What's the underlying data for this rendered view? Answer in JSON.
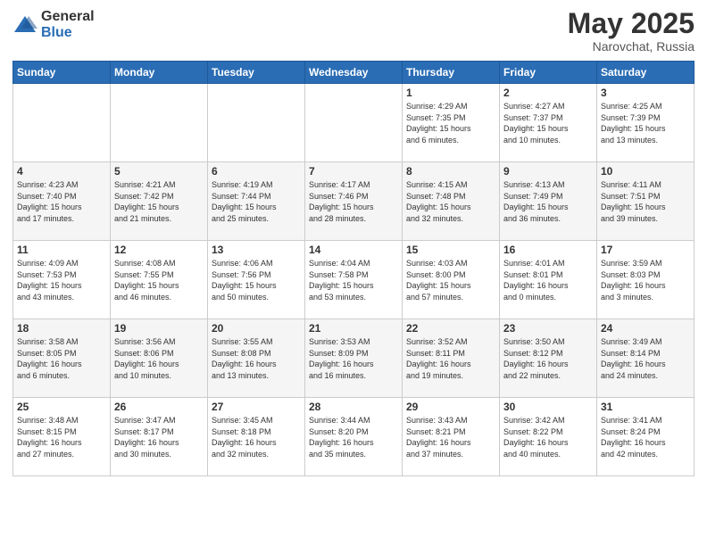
{
  "logo": {
    "general": "General",
    "blue": "Blue"
  },
  "title": {
    "month_year": "May 2025",
    "location": "Narovchat, Russia"
  },
  "weekdays": [
    "Sunday",
    "Monday",
    "Tuesday",
    "Wednesday",
    "Thursday",
    "Friday",
    "Saturday"
  ],
  "weeks": [
    [
      {
        "day": "",
        "info": ""
      },
      {
        "day": "",
        "info": ""
      },
      {
        "day": "",
        "info": ""
      },
      {
        "day": "",
        "info": ""
      },
      {
        "day": "1",
        "info": "Sunrise: 4:29 AM\nSunset: 7:35 PM\nDaylight: 15 hours\nand 6 minutes."
      },
      {
        "day": "2",
        "info": "Sunrise: 4:27 AM\nSunset: 7:37 PM\nDaylight: 15 hours\nand 10 minutes."
      },
      {
        "day": "3",
        "info": "Sunrise: 4:25 AM\nSunset: 7:39 PM\nDaylight: 15 hours\nand 13 minutes."
      }
    ],
    [
      {
        "day": "4",
        "info": "Sunrise: 4:23 AM\nSunset: 7:40 PM\nDaylight: 15 hours\nand 17 minutes."
      },
      {
        "day": "5",
        "info": "Sunrise: 4:21 AM\nSunset: 7:42 PM\nDaylight: 15 hours\nand 21 minutes."
      },
      {
        "day": "6",
        "info": "Sunrise: 4:19 AM\nSunset: 7:44 PM\nDaylight: 15 hours\nand 25 minutes."
      },
      {
        "day": "7",
        "info": "Sunrise: 4:17 AM\nSunset: 7:46 PM\nDaylight: 15 hours\nand 28 minutes."
      },
      {
        "day": "8",
        "info": "Sunrise: 4:15 AM\nSunset: 7:48 PM\nDaylight: 15 hours\nand 32 minutes."
      },
      {
        "day": "9",
        "info": "Sunrise: 4:13 AM\nSunset: 7:49 PM\nDaylight: 15 hours\nand 36 minutes."
      },
      {
        "day": "10",
        "info": "Sunrise: 4:11 AM\nSunset: 7:51 PM\nDaylight: 15 hours\nand 39 minutes."
      }
    ],
    [
      {
        "day": "11",
        "info": "Sunrise: 4:09 AM\nSunset: 7:53 PM\nDaylight: 15 hours\nand 43 minutes."
      },
      {
        "day": "12",
        "info": "Sunrise: 4:08 AM\nSunset: 7:55 PM\nDaylight: 15 hours\nand 46 minutes."
      },
      {
        "day": "13",
        "info": "Sunrise: 4:06 AM\nSunset: 7:56 PM\nDaylight: 15 hours\nand 50 minutes."
      },
      {
        "day": "14",
        "info": "Sunrise: 4:04 AM\nSunset: 7:58 PM\nDaylight: 15 hours\nand 53 minutes."
      },
      {
        "day": "15",
        "info": "Sunrise: 4:03 AM\nSunset: 8:00 PM\nDaylight: 15 hours\nand 57 minutes."
      },
      {
        "day": "16",
        "info": "Sunrise: 4:01 AM\nSunset: 8:01 PM\nDaylight: 16 hours\nand 0 minutes."
      },
      {
        "day": "17",
        "info": "Sunrise: 3:59 AM\nSunset: 8:03 PM\nDaylight: 16 hours\nand 3 minutes."
      }
    ],
    [
      {
        "day": "18",
        "info": "Sunrise: 3:58 AM\nSunset: 8:05 PM\nDaylight: 16 hours\nand 6 minutes."
      },
      {
        "day": "19",
        "info": "Sunrise: 3:56 AM\nSunset: 8:06 PM\nDaylight: 16 hours\nand 10 minutes."
      },
      {
        "day": "20",
        "info": "Sunrise: 3:55 AM\nSunset: 8:08 PM\nDaylight: 16 hours\nand 13 minutes."
      },
      {
        "day": "21",
        "info": "Sunrise: 3:53 AM\nSunset: 8:09 PM\nDaylight: 16 hours\nand 16 minutes."
      },
      {
        "day": "22",
        "info": "Sunrise: 3:52 AM\nSunset: 8:11 PM\nDaylight: 16 hours\nand 19 minutes."
      },
      {
        "day": "23",
        "info": "Sunrise: 3:50 AM\nSunset: 8:12 PM\nDaylight: 16 hours\nand 22 minutes."
      },
      {
        "day": "24",
        "info": "Sunrise: 3:49 AM\nSunset: 8:14 PM\nDaylight: 16 hours\nand 24 minutes."
      }
    ],
    [
      {
        "day": "25",
        "info": "Sunrise: 3:48 AM\nSunset: 8:15 PM\nDaylight: 16 hours\nand 27 minutes."
      },
      {
        "day": "26",
        "info": "Sunrise: 3:47 AM\nSunset: 8:17 PM\nDaylight: 16 hours\nand 30 minutes."
      },
      {
        "day": "27",
        "info": "Sunrise: 3:45 AM\nSunset: 8:18 PM\nDaylight: 16 hours\nand 32 minutes."
      },
      {
        "day": "28",
        "info": "Sunrise: 3:44 AM\nSunset: 8:20 PM\nDaylight: 16 hours\nand 35 minutes."
      },
      {
        "day": "29",
        "info": "Sunrise: 3:43 AM\nSunset: 8:21 PM\nDaylight: 16 hours\nand 37 minutes."
      },
      {
        "day": "30",
        "info": "Sunrise: 3:42 AM\nSunset: 8:22 PM\nDaylight: 16 hours\nand 40 minutes."
      },
      {
        "day": "31",
        "info": "Sunrise: 3:41 AM\nSunset: 8:24 PM\nDaylight: 16 hours\nand 42 minutes."
      }
    ]
  ]
}
